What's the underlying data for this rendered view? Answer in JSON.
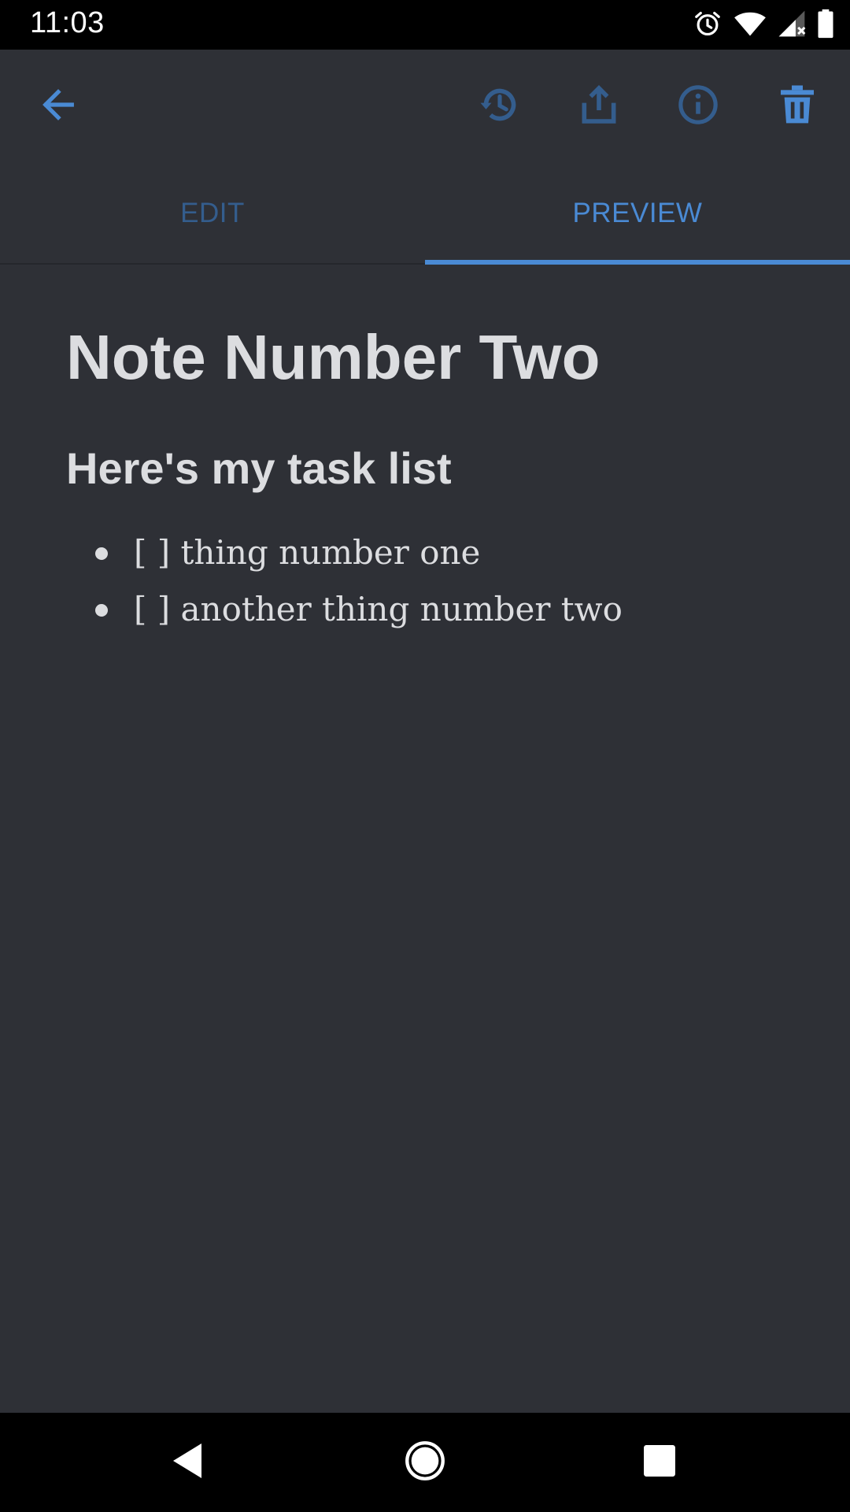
{
  "status_bar": {
    "time": "11:03",
    "icons": [
      "alarm-icon",
      "wifi-icon",
      "signal-icon",
      "battery-icon"
    ]
  },
  "toolbar": {
    "buttons": [
      "back-icon",
      "history-icon",
      "share-icon",
      "info-icon",
      "trash-icon"
    ]
  },
  "tabs": [
    {
      "label": "EDIT",
      "selected": false
    },
    {
      "label": "PREVIEW",
      "selected": true
    }
  ],
  "note": {
    "title": "Note Number Two",
    "heading": "Here's my task list",
    "items": [
      "[ ] thing number one",
      "[ ] another thing number two"
    ]
  },
  "colors": {
    "background": "#2e3036",
    "accent": "#4a8ad4",
    "accent_dim": "#345d8d",
    "text": "#dcdde0"
  },
  "nav_bar": {
    "buttons": [
      "back-triangle-icon",
      "home-circle-icon",
      "recents-square-icon"
    ]
  }
}
